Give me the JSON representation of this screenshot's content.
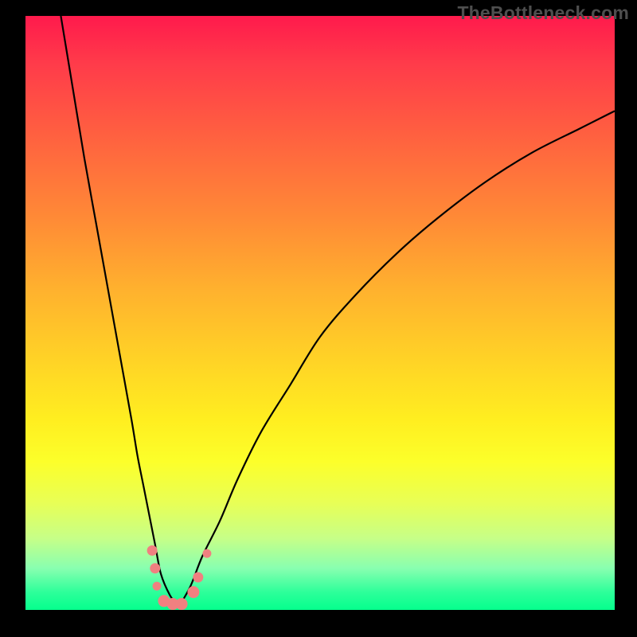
{
  "watermark": "TheBottleneck.com",
  "chart_data": {
    "type": "line",
    "title": "",
    "xlabel": "",
    "ylabel": "",
    "xlim": [
      0,
      100
    ],
    "ylim": [
      0,
      100
    ],
    "series": [
      {
        "name": "left-branch",
        "x": [
          6,
          8,
          10,
          12,
          14,
          16,
          18,
          19,
          20,
          21,
          22,
          23,
          24.5,
          26
        ],
        "values": [
          100,
          88,
          76,
          65,
          54,
          43,
          32,
          26,
          21,
          16,
          11,
          6,
          2.5,
          0.5
        ]
      },
      {
        "name": "right-branch",
        "x": [
          26,
          28,
          30,
          33,
          36,
          40,
          45,
          50,
          56,
          63,
          70,
          78,
          86,
          94,
          100
        ],
        "values": [
          0.5,
          4,
          9,
          15,
          22,
          30,
          38,
          46,
          53,
          60,
          66,
          72,
          77,
          81,
          84
        ]
      }
    ],
    "markers": [
      {
        "x": 21.5,
        "y": 10,
        "r": 6
      },
      {
        "x": 22.0,
        "y": 7,
        "r": 6
      },
      {
        "x": 22.3,
        "y": 4,
        "r": 5
      },
      {
        "x": 23.5,
        "y": 1.5,
        "r": 7
      },
      {
        "x": 25.0,
        "y": 1.0,
        "r": 7
      },
      {
        "x": 26.5,
        "y": 1.0,
        "r": 7
      },
      {
        "x": 28.5,
        "y": 3.0,
        "r": 7
      },
      {
        "x": 29.3,
        "y": 5.5,
        "r": 6
      },
      {
        "x": 30.8,
        "y": 9.5,
        "r": 5
      }
    ]
  },
  "colors": {
    "curve": "#000000",
    "marker": "#f08080",
    "gradient_top": "#ff1a4c",
    "gradient_bottom": "#05ff8d",
    "frame": "#000000"
  }
}
